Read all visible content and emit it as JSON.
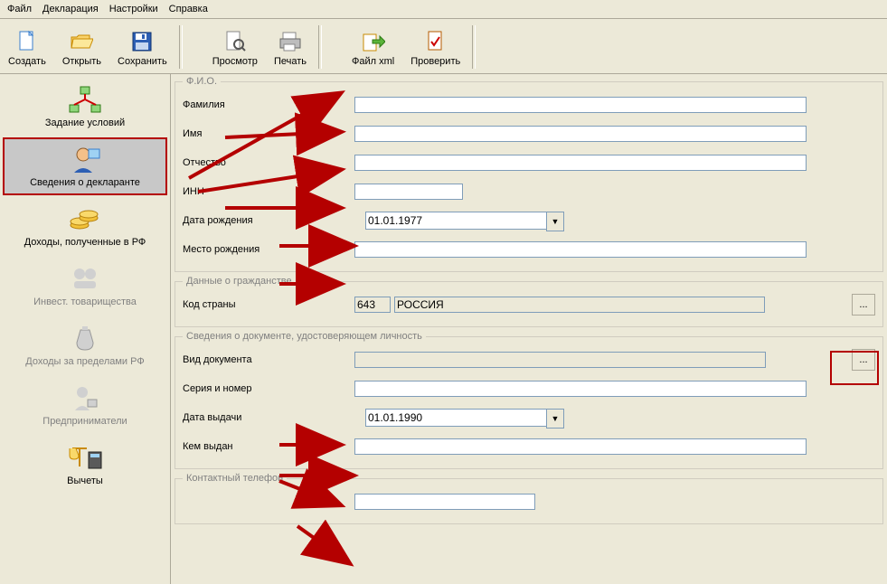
{
  "menu": {
    "items": [
      "Файл",
      "Декларация",
      "Настройки",
      "Справка"
    ]
  },
  "toolbar": {
    "create": "Создать",
    "open": "Открыть",
    "save": "Сохранить",
    "preview": "Просмотр",
    "print": "Печать",
    "xml": "Файл xml",
    "check": "Проверить"
  },
  "sidebar": {
    "items": [
      {
        "label": "Задание условий",
        "active": false,
        "enabled": true
      },
      {
        "label": "Сведения о декларанте",
        "active": true,
        "enabled": true
      },
      {
        "label": "Доходы, полученные в РФ",
        "active": false,
        "enabled": true
      },
      {
        "label": "Инвест. товарищества",
        "active": false,
        "enabled": false
      },
      {
        "label": "Доходы за пределами РФ",
        "active": false,
        "enabled": false
      },
      {
        "label": "Предприниматели",
        "active": false,
        "enabled": false
      },
      {
        "label": "Вычеты",
        "active": false,
        "enabled": true
      }
    ]
  },
  "form": {
    "fio": {
      "legend": "Ф.И.О.",
      "surname_label": "Фамилия",
      "surname": "",
      "name_label": "Имя",
      "name": "",
      "patronymic_label": "Отчество",
      "patronymic": "",
      "inn_label": "ИНН",
      "inn": "",
      "dob_label": "Дата рождения",
      "dob": "01.01.1977",
      "pob_label": "Место рождения",
      "pob": ""
    },
    "cit": {
      "legend": "Данные о гражданстве",
      "code_label": "Код страны",
      "code": "643",
      "country": "РОССИЯ",
      "ellipsis": "..."
    },
    "doc": {
      "legend": "Сведения о документе, удостоверяющем личность",
      "type_label": "Вид документа",
      "type": "",
      "sn_label": "Серия и номер",
      "sn": "",
      "date_label": "Дата выдачи",
      "date": "01.01.1990",
      "issuer_label": "Кем выдан",
      "issuer": "",
      "ellipsis": "..."
    },
    "tel": {
      "legend": "Контактный телефон",
      "value": ""
    }
  }
}
